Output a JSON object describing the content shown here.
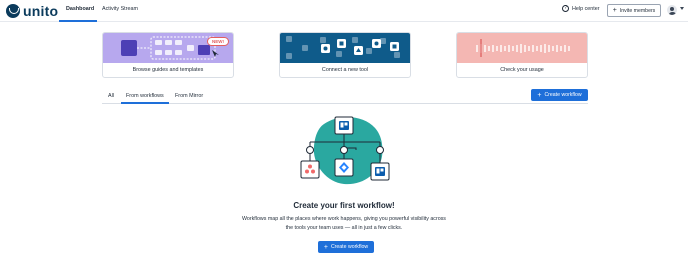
{
  "brand": {
    "name": "unito"
  },
  "nav": {
    "tabs": [
      {
        "label": "Dashboard",
        "active": true
      },
      {
        "label": "Activity Stream",
        "active": false
      }
    ],
    "help_label": "Help center",
    "invite_label": "Invite members",
    "accent": "#1e6fd9"
  },
  "cards": [
    {
      "label": "Browse guides and templates",
      "badge": "NEW!"
    },
    {
      "label": "Connect a new tool"
    },
    {
      "label": "Check your usage"
    }
  ],
  "subtabs": [
    {
      "label": "All",
      "active": false
    },
    {
      "label": "From workflows",
      "active": true
    },
    {
      "label": "From Mirror",
      "active": false
    }
  ],
  "create_button_label": "Create workflow",
  "empty_state": {
    "title": "Create your first workflow!",
    "description": "Workflows map all the places where work happens, giving you powerful visibility across the tools your team uses — all in just a few clicks.",
    "button_label": "Create workflow"
  },
  "colors": {
    "brand_navy": "#0b3b5c",
    "teal": "#2aa8a0",
    "card_guides": "#b7a8ee",
    "card_tools": "#0f5b8a",
    "card_usage": "#f4b7b3"
  }
}
